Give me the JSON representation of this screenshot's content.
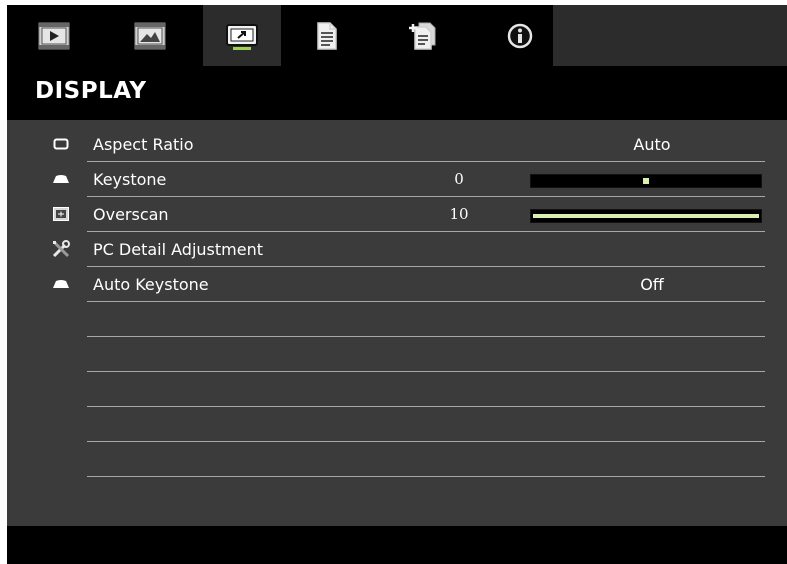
{
  "tabs": [
    {
      "name": "tab-image",
      "icon": "play-screen-icon",
      "active": false
    },
    {
      "name": "tab-display-settings",
      "icon": "picture-frame-icon",
      "active": false
    },
    {
      "name": "tab-display",
      "icon": "monitor-arrow-icon",
      "active": true
    },
    {
      "name": "tab-setup",
      "icon": "document-icon",
      "active": false
    },
    {
      "name": "tab-options",
      "icon": "documents-add-icon",
      "active": false
    },
    {
      "name": "tab-info",
      "icon": "info-icon",
      "active": false
    }
  ],
  "title": "DISPLAY",
  "menu": {
    "aspect_ratio": {
      "label": "Aspect Ratio",
      "value": "Auto",
      "icon": "aspect-ratio-icon"
    },
    "keystone": {
      "label": "Keystone",
      "value": "0",
      "icon": "keystone-icon",
      "level": 0.5
    },
    "overscan": {
      "label": "Overscan",
      "value": "10",
      "icon": "overscan-icon",
      "level": 1.0
    },
    "pc_detail": {
      "label": "PC Detail Adjustment",
      "icon": "tools-icon"
    },
    "auto_keystone": {
      "label": "Auto Keystone",
      "value": "Off",
      "icon": "keystone-icon"
    }
  },
  "colors": {
    "accent": "#d9f0b4",
    "background": "#3b3b3b",
    "bar": "#000000"
  }
}
